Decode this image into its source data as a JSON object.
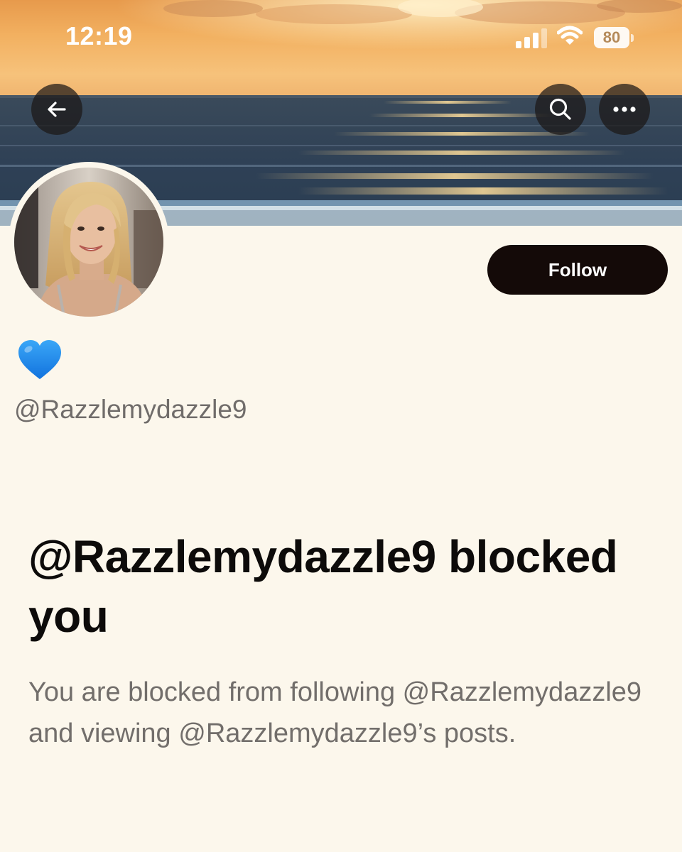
{
  "status_bar": {
    "time": "12:19",
    "battery_level": "80",
    "icons": [
      "signal-bars-icon",
      "wifi-icon",
      "battery-icon"
    ]
  },
  "header": {
    "back_icon": "arrow-left-icon",
    "search_icon": "search-icon",
    "more_icon": "more-horizontal-icon"
  },
  "profile": {
    "display_name_emoji": "blue-heart",
    "handle": "@Razzlemydazzle9",
    "follow_label": "Follow"
  },
  "blocked": {
    "title": "@Razzlemydazzle9 blocked you",
    "message": "You are blocked from following @Razzlemydazzle9 and viewing @Razzlemydazzle9’s posts."
  },
  "colors": {
    "background": "#fcf7ec",
    "follow_button": "#140a08",
    "title_text": "#0d0b0a",
    "secondary_text": "#706c6a",
    "heart": "#1c8cf0"
  }
}
